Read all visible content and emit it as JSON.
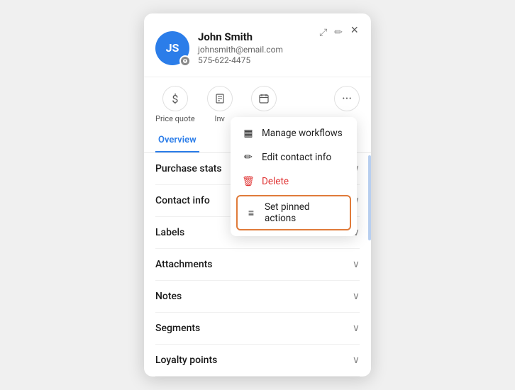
{
  "modal": {
    "close_label": "×"
  },
  "contact": {
    "initials": "JS",
    "name": "John Smith",
    "email": "johnsmith@email.com",
    "phone": "575-622-4475"
  },
  "header_actions": {
    "expand_icon": "⤢",
    "edit_icon": "✏"
  },
  "actions": [
    {
      "label": "Price quote",
      "icon": "$"
    },
    {
      "label": "Inv",
      "icon": "📄"
    },
    {
      "label": "",
      "icon": "📅"
    }
  ],
  "more_icon": "···",
  "dropdown": {
    "items": [
      {
        "key": "manage-workflows",
        "icon": "▦",
        "label": "Manage workflows"
      },
      {
        "key": "edit-contact",
        "icon": "✏",
        "label": "Edit contact info"
      },
      {
        "key": "delete",
        "icon": "🗑",
        "label": "Delete"
      },
      {
        "key": "set-pinned",
        "icon": "≡",
        "label": "Set pinned actions",
        "pinned": true
      }
    ]
  },
  "tabs": [
    {
      "key": "overview",
      "label": "Overview",
      "active": true
    }
  ],
  "sections": [
    {
      "key": "purchase-stats",
      "label": "Purchase stats"
    },
    {
      "key": "contact-info",
      "label": "Contact info"
    },
    {
      "key": "labels",
      "label": "Labels"
    },
    {
      "key": "attachments",
      "label": "Attachments"
    },
    {
      "key": "notes",
      "label": "Notes"
    },
    {
      "key": "segments",
      "label": "Segments"
    },
    {
      "key": "loyalty-points",
      "label": "Loyalty points"
    }
  ]
}
